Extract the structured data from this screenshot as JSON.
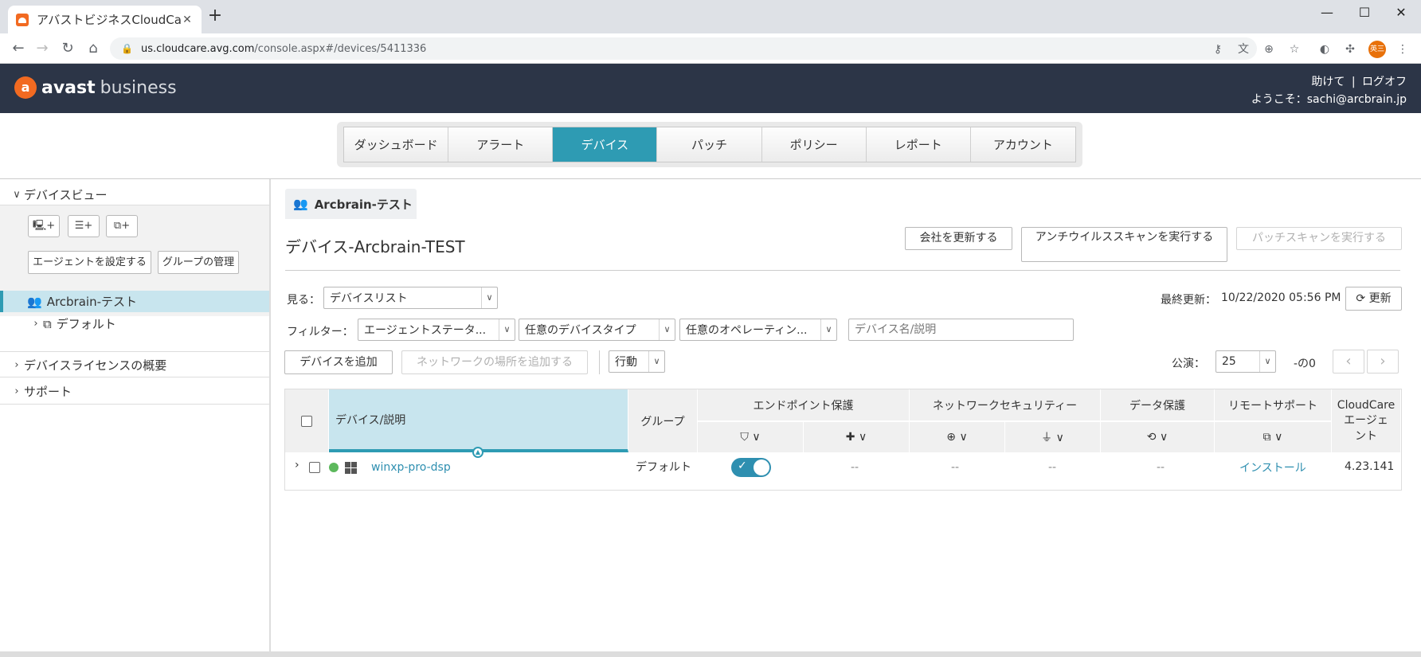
{
  "browser": {
    "tab_title": "アバストビジネスCloudCar",
    "tab_close": "✕",
    "new_tab": "+",
    "url_host": "us.cloudcare.avg.com",
    "url_path": "/console.aspx#/devices/5411336",
    "profile_label": "英三",
    "window": {
      "minimize": "—",
      "maximize": "☐",
      "close": "✕"
    }
  },
  "header": {
    "logo_text": "avast",
    "logo_suffix": "business",
    "help": "助けて",
    "separator": "|",
    "logoff": "ログオフ",
    "welcome": "ようこそ：sachi@arcbrain.jp"
  },
  "main_nav": [
    {
      "label": "ダッシュボード"
    },
    {
      "label": "アラート"
    },
    {
      "label": "デバイス",
      "active": true
    },
    {
      "label": "パッチ"
    },
    {
      "label": "ポリシー"
    },
    {
      "label": "レポート"
    },
    {
      "label": "アカウント"
    }
  ],
  "sidebar": {
    "device_view": "デバイスビュー",
    "icon_buttons": [
      "add-device-icon",
      "add-group-icon",
      "add-subgroup-icon"
    ],
    "set_agent": "エージェントを設定する",
    "manage_groups": "グループの管理",
    "tree_selected": "Arcbrain-テスト",
    "tree_child": "デフォルト",
    "license_overview": "デバイスライセンスの概要",
    "support": "サポート"
  },
  "content": {
    "group_tab": "Arcbrain-テスト",
    "title": "デバイス-Arcbrain-TEST",
    "update_company": "会社を更新する",
    "run_av_scan": "アンチウイルススキャンを実行する",
    "run_patch_scan": "パッチスキャンを実行する",
    "view_label": "見る：",
    "view_value": "デバイスリスト",
    "last_updated_label": "最終更新：",
    "last_updated": "10/22/2020 05:56 PM",
    "refresh": "更新",
    "filter_label": "フィルター：",
    "filter_agent_status": "エージェントステータ...",
    "filter_device_type": "任意のデバイスタイプ",
    "filter_os": "任意のオペレーティン...",
    "search_placeholder": "デバイス名/説明",
    "add_device": "デバイスを追加",
    "add_network_location": "ネットワークの場所を追加する",
    "action": "行動",
    "per_page_label": "公演：",
    "per_page_value": "25",
    "page_info": "-の0"
  },
  "table": {
    "col_device": "デバイス/説明",
    "col_group": "グループ",
    "col_endpoint": "エンドポイント保護",
    "col_network": "ネットワークセキュリティー",
    "col_data": "データ保護",
    "col_remote": "リモートサポート",
    "col_agent_line1": "CloudCare",
    "col_agent_line2": "エージェ",
    "col_agent_line3": "ント",
    "rows": [
      {
        "device": "winxp-pro-dsp",
        "group": "デフォルト",
        "patch": "--",
        "web": "--",
        "firewall": "--",
        "backup": "--",
        "remote": "インストール",
        "agent_version": "4.23.141"
      }
    ]
  },
  "colors": {
    "accent": "#2e9bb3",
    "header_bg": "#2c3547",
    "brand_orange": "#f26a21",
    "status_online": "#5cb85c"
  }
}
